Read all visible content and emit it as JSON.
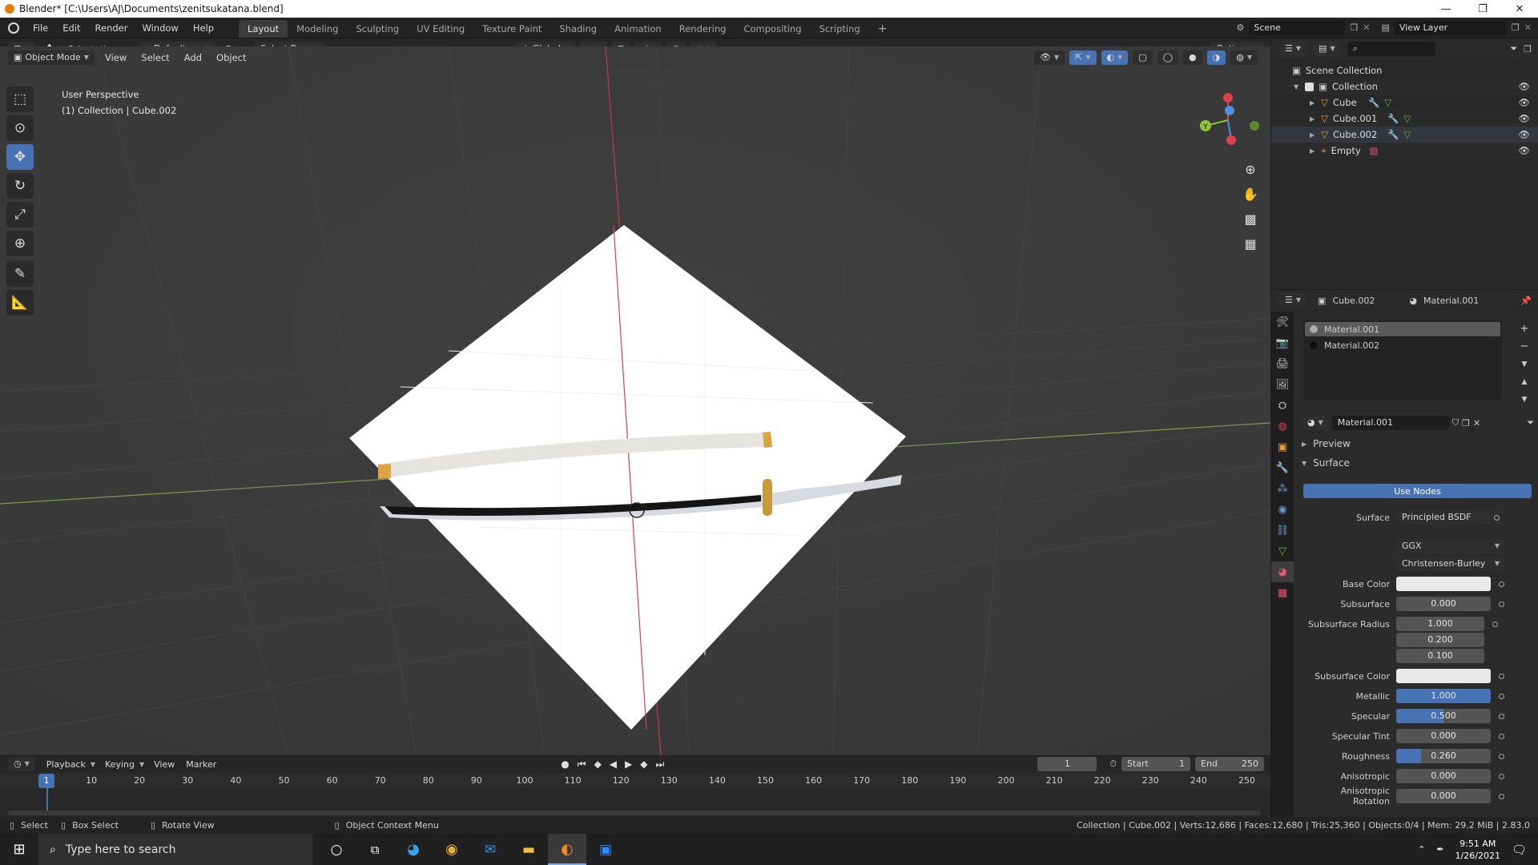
{
  "window": {
    "title": "Blender* [C:\\Users\\AJ\\Documents\\zenitsukatana.blend]",
    "buttons": [
      "—",
      "❐",
      "✕"
    ]
  },
  "menu": [
    "File",
    "Edit",
    "Render",
    "Window",
    "Help"
  ],
  "workspaces": [
    {
      "label": "Layout",
      "active": true
    },
    {
      "label": "Modeling"
    },
    {
      "label": "Sculpting"
    },
    {
      "label": "UV Editing"
    },
    {
      "label": "Texture Paint"
    },
    {
      "label": "Shading"
    },
    {
      "label": "Animation"
    },
    {
      "label": "Rendering"
    },
    {
      "label": "Compositing"
    },
    {
      "label": "Scripting"
    }
  ],
  "scene": {
    "name": "Scene",
    "view_layer": "View Layer"
  },
  "tool_header": {
    "orientation_label": "Orientation:",
    "orientation_value": "Default",
    "drag_label": "Drag:",
    "drag_value": "Select Box",
    "transform_orientation": "Global",
    "options": "Options"
  },
  "viewport_header": {
    "mode": "Object Mode",
    "menus": [
      "View",
      "Select",
      "Add",
      "Object"
    ]
  },
  "viewport": {
    "overlay_line1": "User Perspective",
    "overlay_line2": "(1) Collection | Cube.002",
    "gizmo_y": "Y"
  },
  "outliner": {
    "root": "Scene Collection",
    "collection": "Collection",
    "items": [
      "Cube",
      "Cube.001",
      "Cube.002",
      "Empty"
    ]
  },
  "properties": {
    "object_name": "Cube.002",
    "material_name": "Material.001",
    "slots": [
      "Material.001",
      "Material.002"
    ],
    "material_field": "Material.001",
    "panel_preview": "Preview",
    "panel_surface": "Surface",
    "use_nodes": "Use Nodes",
    "surface_label": "Surface",
    "surface_value": "Principled BSDF",
    "distribution": "GGX",
    "subsurface_method": "Christensen-Burley",
    "rows": [
      {
        "label": "Base Color",
        "value": "",
        "kind": "color"
      },
      {
        "label": "Subsurface",
        "value": "0.000"
      },
      {
        "label": "Subsurface Radius",
        "value": "1.000"
      },
      {
        "label": "",
        "value": "0.200"
      },
      {
        "label": "",
        "value": "0.100"
      },
      {
        "label": "Subsurface Color",
        "value": "",
        "kind": "color"
      },
      {
        "label": "Metallic",
        "value": "1.000",
        "fill": 1.0
      },
      {
        "label": "Specular",
        "value": "0.500",
        "fill": 0.5
      },
      {
        "label": "Specular Tint",
        "value": "0.000"
      },
      {
        "label": "Roughness",
        "value": "0.260",
        "fill": 0.26
      },
      {
        "label": "Anisotropic",
        "value": "0.000"
      },
      {
        "label": "Anisotropic Rotation",
        "value": "0.000"
      }
    ]
  },
  "timeline": {
    "menus": [
      "Playback",
      "Keying",
      "View",
      "Marker"
    ],
    "current_frame": "1",
    "start_label": "Start",
    "start": "1",
    "end_label": "End",
    "end": "250",
    "ticks": [
      "10",
      "20",
      "30",
      "40",
      "50",
      "60",
      "70",
      "80",
      "90",
      "100",
      "110",
      "120",
      "130",
      "140",
      "150",
      "160",
      "170",
      "180",
      "190",
      "200",
      "210",
      "220",
      "230",
      "240",
      "250"
    ],
    "playhead": "1"
  },
  "statusbar": {
    "select": "Select",
    "box_select": "Box Select",
    "rotate_view": "Rotate View",
    "context_menu": "Object Context Menu",
    "stats": "Collection | Cube.002 | Verts:12,686 | Faces:12,680 | Tris:25,360 | Objects:0/4 | Mem: 29.2 MiB | 2.83.0"
  },
  "taskbar": {
    "search_placeholder": "Type here to search",
    "time": "9:51 AM",
    "date": "1/26/2021"
  }
}
